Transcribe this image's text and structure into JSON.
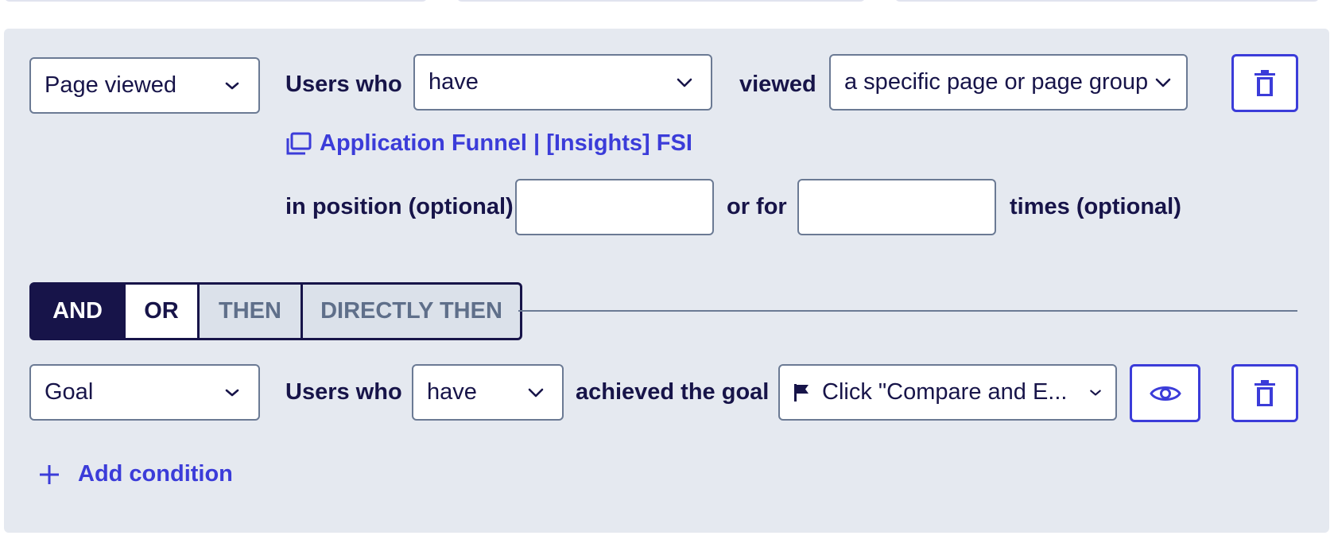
{
  "condition1": {
    "type_select": "Page viewed",
    "users_who_label": "Users who",
    "have_select": "have",
    "viewed_label": "viewed",
    "target_select": "a specific page or page group",
    "page_link": "Application Funnel | [Insights] FSI",
    "position_label": "in position (optional)",
    "position_value": "",
    "or_for_label": "or for",
    "times_value": "",
    "times_label": "times (optional)"
  },
  "operators": {
    "and": "AND",
    "or": "OR",
    "then": "THEN",
    "directly_then": "DIRECTLY THEN",
    "selected": "AND"
  },
  "condition2": {
    "type_select": "Goal",
    "users_who_label": "Users who",
    "have_select": "have",
    "achieved_label": "achieved the goal",
    "goal_select": "Click \"Compare and E..."
  },
  "add_condition": {
    "label": "Add condition"
  },
  "icons": {
    "delete": "trash-icon",
    "preview": "eye-icon",
    "goal": "flag-icon",
    "page_group": "page-group-icon",
    "add": "plus-icon",
    "dropdown": "chevron-down-icon"
  },
  "colors": {
    "primary": "#3b3cd9",
    "dark": "#171449",
    "panel": "#e5e9f0",
    "muted": "#5f6f8a"
  }
}
